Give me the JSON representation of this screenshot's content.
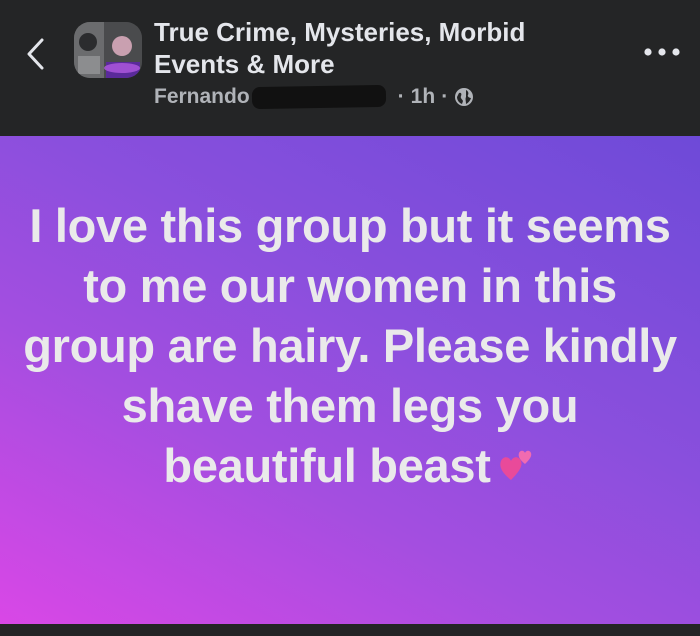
{
  "header": {
    "group_title": "True Crime, Mysteries, Morbid Events & More",
    "author": "Fernando",
    "time": "1h",
    "separator": "·",
    "icons": {
      "back": "chevron-left-icon",
      "privacy": "globe-icon",
      "more": "more-options-icon"
    }
  },
  "post": {
    "text": "I love this group but it seems to me our women in this group are hairy. Please kindly shave them legs you beautiful beast",
    "emoji": "two-hearts-icon",
    "background_colors": [
      "#d947e6",
      "#8a4fdd",
      "#6e4ad8"
    ]
  },
  "colors": {
    "background": "#242526",
    "title_text": "#e4e6eb",
    "meta_text": "#b0b3b8",
    "post_text": "#eaeaea"
  }
}
